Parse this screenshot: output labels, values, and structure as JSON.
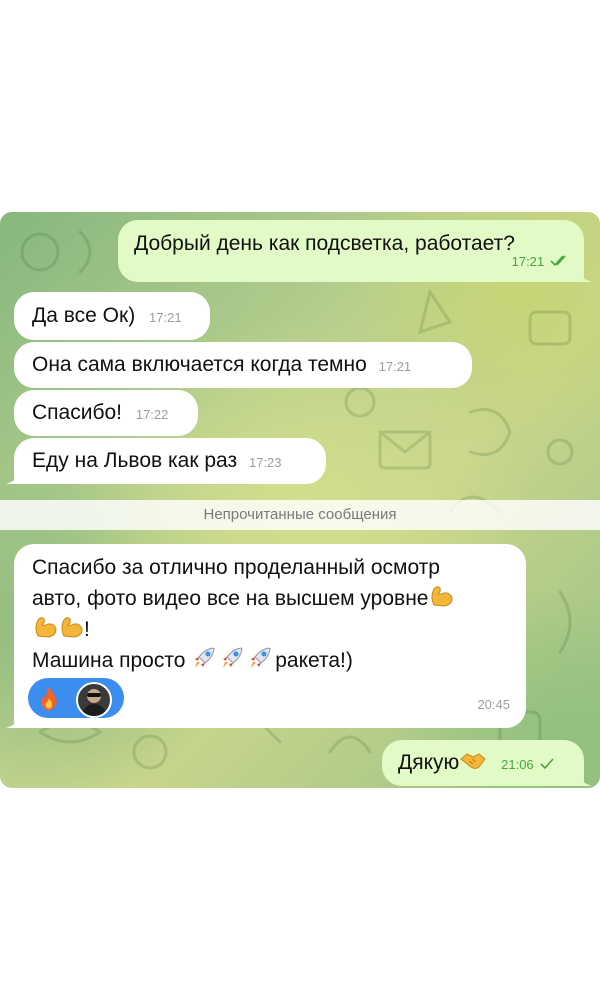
{
  "messages": {
    "m1": {
      "text": "Добрый день как подсветка, работает?",
      "time": "17:21"
    },
    "m2": {
      "text": "Да все Ок)",
      "time": "17:21"
    },
    "m3": {
      "text": "Она сама включается когда темно",
      "time": "17:21"
    },
    "m4": {
      "text": "Спасибо!",
      "time": "17:22"
    },
    "m5": {
      "text": "Еду на Львов как раз",
      "time": "17:23"
    },
    "m6": {
      "line1": "Спасибо за отлично проделанный осмотр",
      "line2": "авто, фото видео все на высшем уровне",
      "line3_end": "!",
      "line4_start": "Машина просто ",
      "line4_end": "ракета!)",
      "time": "20:45"
    },
    "m7": {
      "text": "Дякую",
      "time": "21:06"
    }
  },
  "unread_divider": "Непрочитанные сообщения",
  "icons": {
    "double_check": "double-check-icon",
    "single_check": "check-icon",
    "muscle": "flexed-biceps-emoji",
    "rocket": "rocket-emoji",
    "handshake": "handshake-emoji",
    "fire": "fire-emoji"
  },
  "colors": {
    "outgoing_bubble": "#e2fbc6",
    "incoming_bubble": "#ffffff",
    "check": "#4aa53c",
    "reaction": "#3b8ef0"
  }
}
